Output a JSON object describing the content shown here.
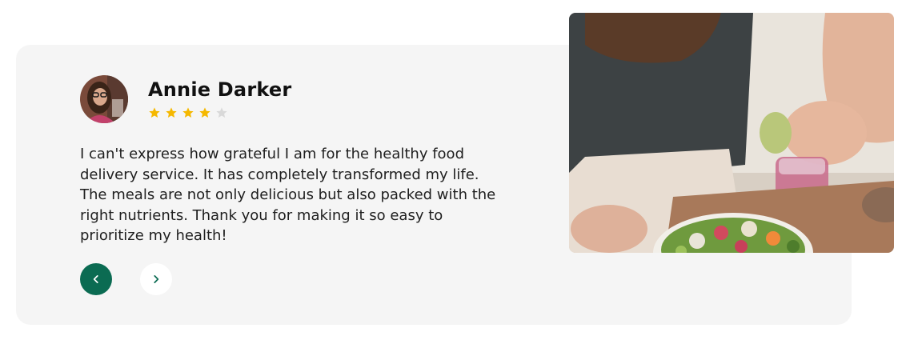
{
  "testimonial": {
    "name": "Annie Darker",
    "rating": 4,
    "rating_max": 5,
    "quote": "I can't express how grateful I am for the healthy food delivery service. It has completely transformed my life. The meals are not only delicious but also packed with the right nutrients. Thank you for making it so easy to prioritize my health!",
    "avatar_icon": "avatar-photo",
    "photo": "woman-preparing-salad-photo"
  },
  "navigation": {
    "prev_icon": "chevron-left-icon",
    "next_icon": "chevron-right-icon"
  },
  "colors": {
    "card_background": "#f5f5f5",
    "accent": "#0b6b52",
    "star_filled": "#f5b800",
    "star_empty": "#d9d9d9",
    "text": "#1e1e1e"
  }
}
